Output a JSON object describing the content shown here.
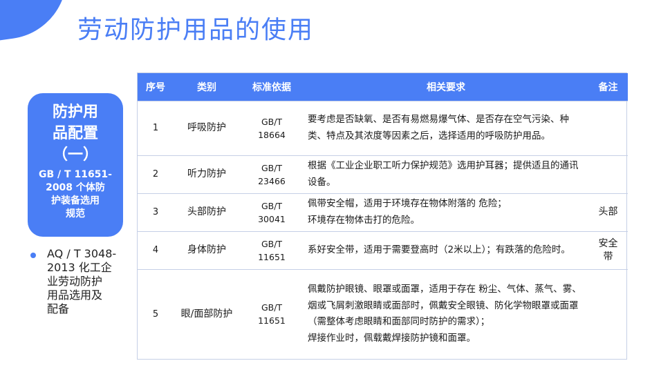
{
  "title": "劳动防护用品的使用",
  "side_card": {
    "heading": "防护用\n品配置\n（一）",
    "subheading": "GB / T 11651-\n2008 个体防\n护装备选用\n规范"
  },
  "bullet": {
    "text": "AQ / T  3048-\n2013 化工企\n业劳动防护\n用品选用及\n配备"
  },
  "table": {
    "headers": [
      "序号",
      "类别",
      "标准依据",
      "相关要求",
      "备注"
    ],
    "rows": [
      {
        "num": "1",
        "category": "呼吸防护",
        "standard": "GB/T\n18664",
        "requirement": "要考虑是否缺氧、是否有易燃易爆气体、是否存在空气污染、种类、特点及其浓度等因素之后，选择适用的呼吸防护用品。",
        "note": ""
      },
      {
        "num": "2",
        "category": "听力防护",
        "standard": "GB/T\n23466",
        "requirement": "根据《工业企业职工听力保护规范》选用护耳器；提供适且的通讯设备。",
        "note": ""
      },
      {
        "num": "3",
        "category": "头部防护",
        "standard": "GB/T\n30041",
        "requirement": "佩带安全帽，适用于环境存在物体附落的 危险；\n环境存在物体击打的危险。",
        "note": "头部"
      },
      {
        "num": "4",
        "category": "身体防护",
        "standard": "GB/T\n11651",
        "requirement": "系好安全带，适用于需要登高时（2米以上）；有跌落的危险时。",
        "note": "安全\n带"
      },
      {
        "num": "5",
        "category": "眼/面部防护",
        "standard": "GB/T\n11651",
        "requirement": "佩戴防护眼镜、眼罩或面罩，适用于存在 粉尘、气体、蒸气、雾、烟或飞屑刺激眼睛或面部时，佩戴安全眼镜、防化学物眼罩或面罩（需整体考虑眼睛和面部同时防护的需求）；\n焊接作业时，佩载戴焊接防护镜和面罩。",
        "note": ""
      }
    ]
  }
}
